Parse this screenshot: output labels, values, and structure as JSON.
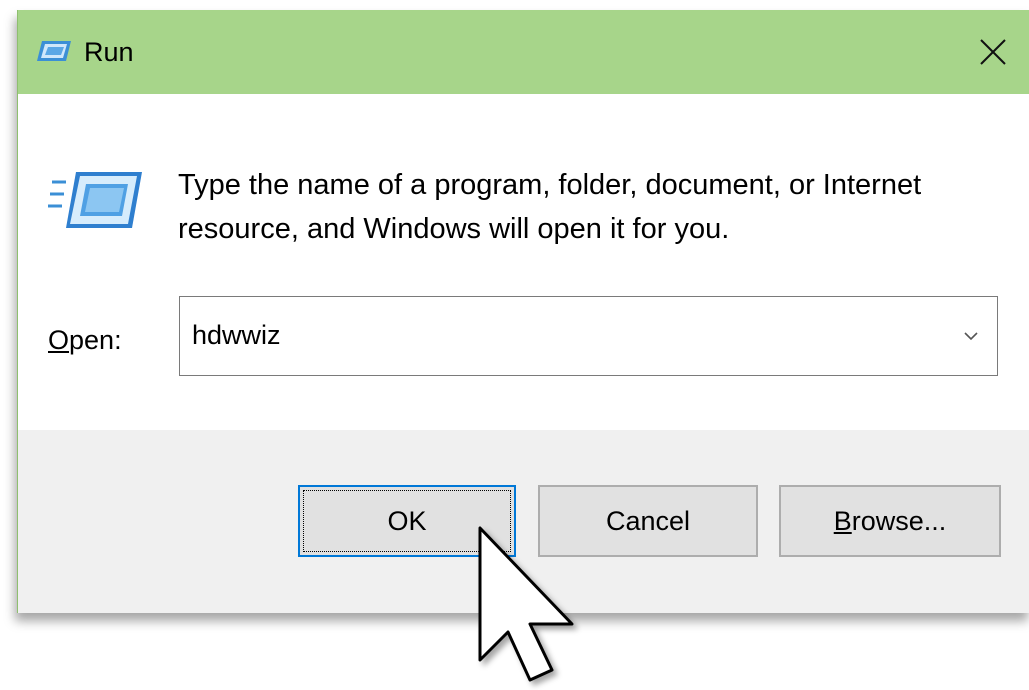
{
  "window": {
    "title": "Run"
  },
  "description": "Type the name of a program, folder, document, or Internet resource, and Windows will open it for you.",
  "open_field": {
    "label_accel": "O",
    "label_rest": "pen:",
    "value": "hdwwiz"
  },
  "buttons": {
    "ok": "OK",
    "cancel": "Cancel",
    "browse_accel": "B",
    "browse_rest": "rowse..."
  },
  "colors": {
    "titlebar": "#a7d58a",
    "footer": "#f0f0f0",
    "focus_border": "#0078d7"
  },
  "icons": [
    "run-icon",
    "close-icon",
    "chevron-down-icon",
    "mouse-pointer-icon"
  ]
}
